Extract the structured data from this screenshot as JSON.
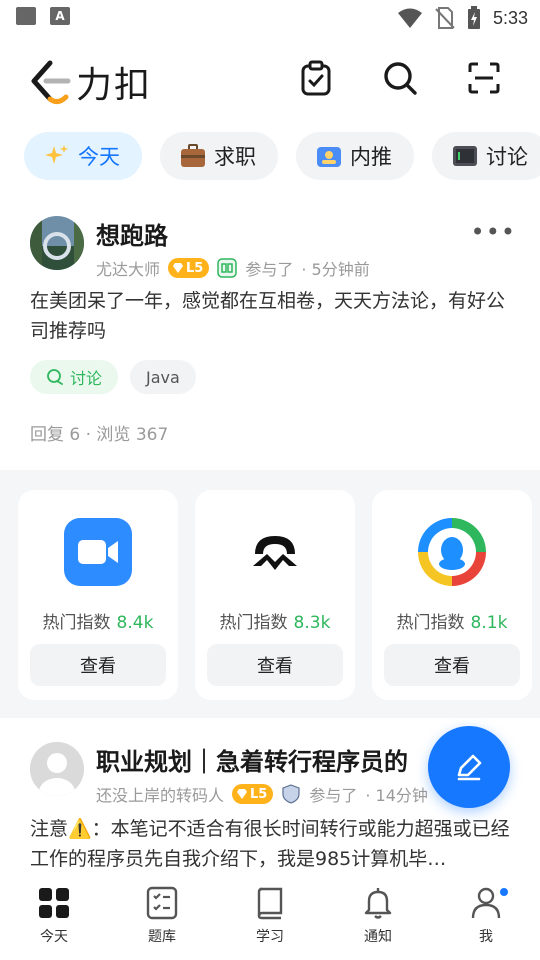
{
  "status_bar": {
    "time": "5:33"
  },
  "header": {
    "logo_text": "力扣"
  },
  "tabs": [
    {
      "label": "今天",
      "active": true
    },
    {
      "label": "求职"
    },
    {
      "label": "内推"
    },
    {
      "label": "讨论"
    }
  ],
  "post": {
    "author": "想跑路",
    "author_title": "尤达大师",
    "level": "L5",
    "joined": "参与了",
    "time": "· 5分钟前",
    "content": "在美团呆了一年，感觉都在互相卷，天天方法论，有好公司推荐吗",
    "tags": [
      {
        "label": "讨论"
      },
      {
        "label": "Java"
      }
    ],
    "stats": "回复 6 · 浏览 367"
  },
  "companies": [
    {
      "hot_label": "热门指数",
      "hot_value": "8.4k",
      "button": "查看",
      "icon": "zoom-icon"
    },
    {
      "hot_label": "热门指数",
      "hot_value": "8.3k",
      "button": "查看",
      "icon": "nio-icon"
    },
    {
      "hot_label": "热门指数",
      "hot_value": "8.1k",
      "button": "查看",
      "icon": "tencent-icon"
    }
  ],
  "post2": {
    "title": "职业规划｜急着转行程序员的",
    "author_title": "还没上岸的转码人",
    "level": "L5",
    "joined": "参与了",
    "time": "· 14分钟",
    "content": "注意⚠️：本笔记不适合有很长时间转行或能力超强或已经工作的程序员先自我介绍下，我是985计算机毕…"
  },
  "bottom_nav": [
    {
      "label": "今天",
      "icon": "today-icon",
      "active": true
    },
    {
      "label": "题库",
      "icon": "problem-list-icon"
    },
    {
      "label": "学习",
      "icon": "book-icon"
    },
    {
      "label": "通知",
      "icon": "bell-icon"
    },
    {
      "label": "我",
      "icon": "profile-icon",
      "badge": true
    }
  ],
  "colors": {
    "accent": "#1677ff",
    "green": "#2fb75d",
    "level_badge": "#ffb21a"
  }
}
